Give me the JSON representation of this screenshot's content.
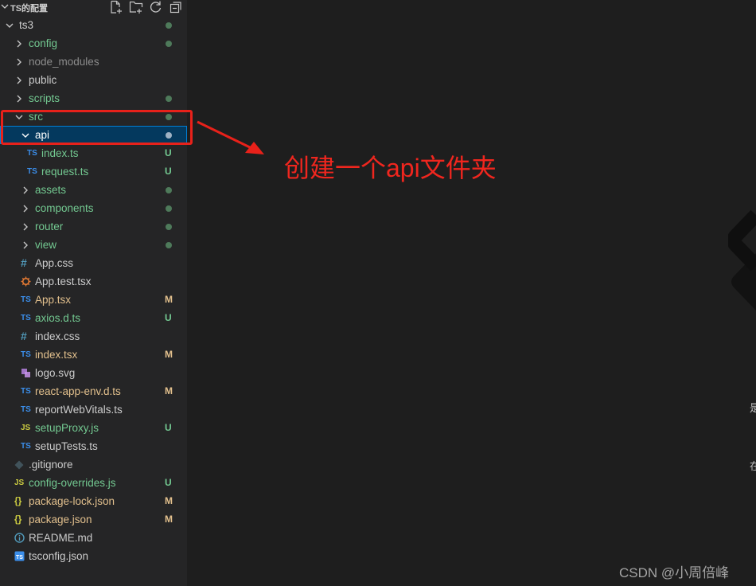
{
  "explorer": {
    "title": "TS的配置",
    "actions": [
      {
        "name": "new-file-button",
        "icon": "new-file-icon"
      },
      {
        "name": "new-folder-button",
        "icon": "new-folder-icon"
      },
      {
        "name": "refresh-explorer-button",
        "icon": "refresh-icon"
      },
      {
        "name": "collapse-folders-button",
        "icon": "collapse-all-icon"
      }
    ]
  },
  "tree": [
    {
      "label": "ts3",
      "kind": "folder",
      "open": true,
      "depth": 0,
      "color": "#cccccc",
      "dot": true
    },
    {
      "label": "config",
      "kind": "folder",
      "open": false,
      "depth": 1,
      "color": "#73c991",
      "dot": true
    },
    {
      "label": "node_modules",
      "kind": "folder",
      "open": false,
      "depth": 1,
      "color": "#8c8c8c"
    },
    {
      "label": "public",
      "kind": "folder",
      "open": false,
      "depth": 1,
      "color": "#cccccc"
    },
    {
      "label": "scripts",
      "kind": "folder",
      "open": false,
      "depth": 1,
      "color": "#73c991",
      "dot": true
    },
    {
      "label": "src",
      "kind": "folder",
      "open": true,
      "depth": 1,
      "color": "#73c991",
      "dot": true
    },
    {
      "label": "api",
      "kind": "folder",
      "open": true,
      "depth": 2,
      "color": "#ffffff",
      "dot": true,
      "selected": true
    },
    {
      "label": "index.ts",
      "kind": "ts",
      "depth": 3,
      "color": "#73c991",
      "badge": "U"
    },
    {
      "label": "request.ts",
      "kind": "ts",
      "depth": 3,
      "color": "#73c991",
      "badge": "U"
    },
    {
      "label": "assets",
      "kind": "folder",
      "open": false,
      "depth": 2,
      "color": "#73c991",
      "dot": true
    },
    {
      "label": "components",
      "kind": "folder",
      "open": false,
      "depth": 2,
      "color": "#73c991",
      "dot": true
    },
    {
      "label": "router",
      "kind": "folder",
      "open": false,
      "depth": 2,
      "color": "#73c991",
      "dot": true
    },
    {
      "label": "view",
      "kind": "folder",
      "open": false,
      "depth": 2,
      "color": "#73c991",
      "dot": true
    },
    {
      "label": "App.css",
      "kind": "css",
      "depth": 2,
      "color": "#cccccc"
    },
    {
      "label": "App.test.tsx",
      "kind": "test",
      "depth": 2,
      "color": "#cccccc"
    },
    {
      "label": "App.tsx",
      "kind": "ts",
      "depth": 2,
      "color": "#e2c08d",
      "badge": "M"
    },
    {
      "label": "axios.d.ts",
      "kind": "ts",
      "depth": 2,
      "color": "#73c991",
      "badge": "U"
    },
    {
      "label": "index.css",
      "kind": "css",
      "depth": 2,
      "color": "#cccccc"
    },
    {
      "label": "index.tsx",
      "kind": "ts",
      "depth": 2,
      "color": "#e2c08d",
      "badge": "M"
    },
    {
      "label": "logo.svg",
      "kind": "svg",
      "depth": 2,
      "color": "#cccccc"
    },
    {
      "label": "react-app-env.d.ts",
      "kind": "ts",
      "depth": 2,
      "color": "#e2c08d",
      "badge": "M"
    },
    {
      "label": "reportWebVitals.ts",
      "kind": "ts",
      "depth": 2,
      "color": "#cccccc"
    },
    {
      "label": "setupProxy.js",
      "kind": "js",
      "depth": 2,
      "color": "#73c991",
      "badge": "U"
    },
    {
      "label": "setupTests.ts",
      "kind": "ts",
      "depth": 2,
      "color": "#cccccc"
    },
    {
      "label": ".gitignore",
      "kind": "git",
      "depth": 1,
      "color": "#cccccc"
    },
    {
      "label": "config-overrides.js",
      "kind": "js",
      "depth": 1,
      "color": "#73c991",
      "badge": "U"
    },
    {
      "label": "package-lock.json",
      "kind": "json",
      "depth": 1,
      "color": "#e2c08d",
      "badge": "M"
    },
    {
      "label": "package.json",
      "kind": "json",
      "depth": 1,
      "color": "#e2c08d",
      "badge": "M"
    },
    {
      "label": "README.md",
      "kind": "info",
      "depth": 1,
      "color": "#cccccc"
    },
    {
      "label": "tsconfig.json",
      "kind": "tsconfig",
      "depth": 1,
      "color": "#cccccc"
    }
  ],
  "annotation": {
    "text": "创建一个api文件夹",
    "color": "#f0261e"
  },
  "edge_text": [
    "是",
    "在"
  ],
  "watermark": "CSDN @小周倍峰",
  "colors": {
    "sidebar_bg": "#252526",
    "editor_bg": "#1e1e1e",
    "untracked": "#73c991",
    "modified": "#e2c08d",
    "selection": "#04395e"
  }
}
